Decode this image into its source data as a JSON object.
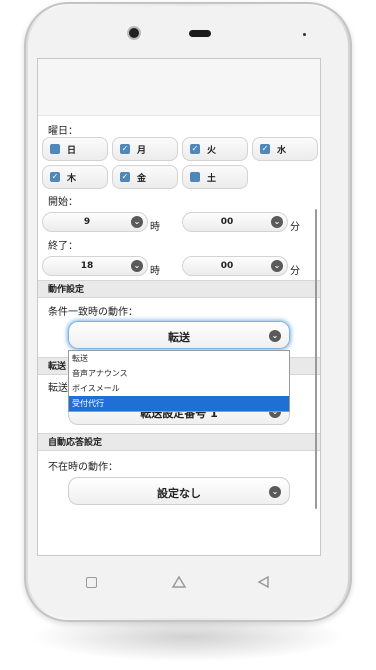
{
  "days": {
    "label": "曜日：",
    "items": [
      {
        "name": "日",
        "checked": false
      },
      {
        "name": "月",
        "checked": true
      },
      {
        "name": "火",
        "checked": true
      },
      {
        "name": "水",
        "checked": true
      },
      {
        "name": "木",
        "checked": true
      },
      {
        "name": "金",
        "checked": true
      },
      {
        "name": "土",
        "checked": false
      }
    ]
  },
  "start": {
    "label": "開始：",
    "hour": "9",
    "hour_unit": "時",
    "minute": "00",
    "minute_unit": "分"
  },
  "end": {
    "label": "終了：",
    "hour": "18",
    "hour_unit": "時",
    "minute": "00",
    "minute_unit": "分"
  },
  "action_settings": {
    "header": "動作設定",
    "condition_label": "条件一致時の動作：",
    "selected": "転送",
    "options": [
      "転送",
      "音声アナウンス",
      "ボイスメール",
      "受付代行"
    ],
    "highlighted_option": "受付代行"
  },
  "forward_settings": {
    "header_partial": "転送",
    "label_partial": "転送",
    "selected": "転送設定番号 1"
  },
  "auto_response": {
    "header": "自動応答設定",
    "absent_label": "不在時の動作：",
    "selected": "設定なし"
  },
  "icons": {
    "chevron": "chevron-down-icon",
    "checkbox": "checkbox-icon",
    "nav_recent": "square-icon",
    "nav_home": "home-icon",
    "nav_back": "back-icon"
  },
  "colors": {
    "checkbox": "#4f87b9",
    "highlight": "#1f6fd6"
  }
}
